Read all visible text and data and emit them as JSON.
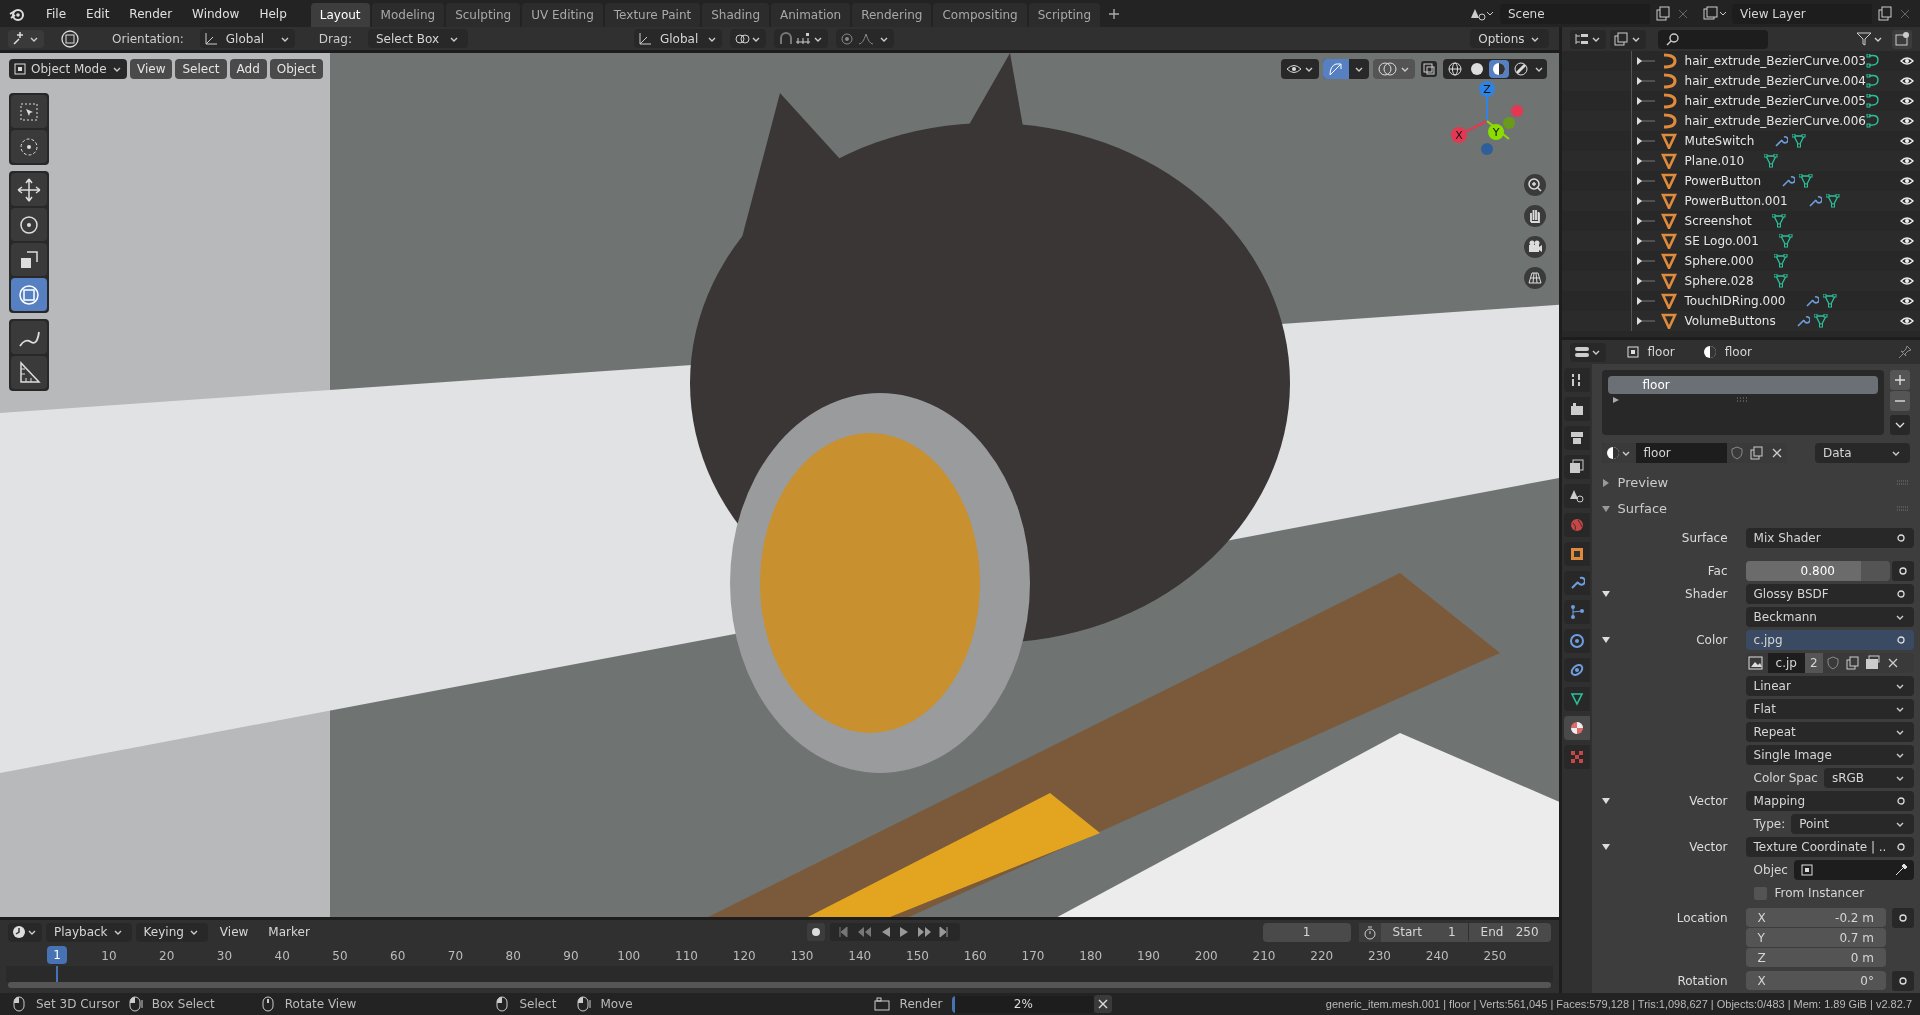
{
  "menu": [
    "File",
    "Edit",
    "Render",
    "Window",
    "Help"
  ],
  "workspaces": [
    {
      "label": "Layout",
      "selected": true
    },
    {
      "label": "Modeling",
      "selected": false
    },
    {
      "label": "Sculpting",
      "selected": false
    },
    {
      "label": "UV Editing",
      "selected": false
    },
    {
      "label": "Texture Paint",
      "selected": false
    },
    {
      "label": "Shading",
      "selected": false
    },
    {
      "label": "Animation",
      "selected": false
    },
    {
      "label": "Rendering",
      "selected": false
    },
    {
      "label": "Compositing",
      "selected": false
    },
    {
      "label": "Scripting",
      "selected": false
    }
  ],
  "scene": "Scene",
  "view_layer": "View Layer",
  "tool_header": {
    "orientation_label": "Orientation:",
    "orientation": "Global",
    "drag_label": "Drag:",
    "drag": "Select Box",
    "transform_orientation": "Global",
    "options": "Options"
  },
  "viewport_header": {
    "mode": "Object Mode",
    "menus": [
      "View",
      "Select",
      "Add",
      "Object"
    ]
  },
  "viewport_overlays": {
    "on": true
  },
  "viewport_shading": [
    {
      "kind": "wireframe",
      "selected": false
    },
    {
      "kind": "solid",
      "selected": false
    },
    {
      "kind": "material",
      "selected": true
    },
    {
      "kind": "rendered",
      "selected": false
    }
  ],
  "tools": [
    {
      "kind": "select",
      "selected": false
    },
    {
      "kind": "cursor",
      "selected": false
    },
    {
      "kind": "move",
      "selected": false
    },
    {
      "kind": "rotate",
      "selected": false
    },
    {
      "kind": "scale",
      "selected": false
    },
    {
      "kind": "transform",
      "selected": true
    },
    {
      "kind": "annotate",
      "selected": false
    },
    {
      "kind": "measure",
      "selected": false
    }
  ],
  "gizmo_axes": [
    "X",
    "Y",
    "Z"
  ],
  "outliner": [
    {
      "name": "hair_extrude_BezierCurve.003",
      "kind": "curve",
      "modifier": false
    },
    {
      "name": "hair_extrude_BezierCurve.004",
      "kind": "curve",
      "modifier": false
    },
    {
      "name": "hair_extrude_BezierCurve.005",
      "kind": "curve",
      "modifier": false
    },
    {
      "name": "hair_extrude_BezierCurve.006",
      "kind": "curve",
      "modifier": false
    },
    {
      "name": "MuteSwitch",
      "kind": "mesh",
      "modifier": true
    },
    {
      "name": "Plane.010",
      "kind": "mesh",
      "modifier": false
    },
    {
      "name": "PowerButton",
      "kind": "mesh",
      "modifier": true
    },
    {
      "name": "PowerButton.001",
      "kind": "mesh",
      "modifier": true
    },
    {
      "name": "Screenshot",
      "kind": "mesh",
      "modifier": false
    },
    {
      "name": "SE Logo.001",
      "kind": "mesh",
      "modifier": false
    },
    {
      "name": "Sphere.000",
      "kind": "mesh",
      "modifier": false
    },
    {
      "name": "Sphere.028",
      "kind": "mesh",
      "modifier": false
    },
    {
      "name": "TouchIDRing.000",
      "kind": "mesh",
      "modifier": true
    },
    {
      "name": "VolumeButtons",
      "kind": "mesh",
      "modifier": true
    }
  ],
  "properties": {
    "breadcrumbs": [
      "floor",
      "floor"
    ],
    "tabs": [
      {
        "kind": "tool",
        "selected": false
      },
      {
        "kind": "render",
        "selected": false
      },
      {
        "kind": "output",
        "selected": false
      },
      {
        "kind": "view_layer",
        "selected": false
      },
      {
        "kind": "scene",
        "selected": false
      },
      {
        "kind": "world",
        "selected": false
      },
      {
        "kind": "object",
        "selected": false
      },
      {
        "kind": "modifiers",
        "selected": false
      },
      {
        "kind": "particles",
        "selected": false
      },
      {
        "kind": "physics",
        "selected": false
      },
      {
        "kind": "constraints",
        "selected": false
      },
      {
        "kind": "data",
        "selected": false
      },
      {
        "kind": "material",
        "selected": true
      },
      {
        "kind": "texture",
        "selected": false
      }
    ],
    "slots": [
      {
        "name": "floor",
        "selected": true
      }
    ],
    "material": "floor",
    "link": "Data",
    "panels": [
      {
        "title": "Preview",
        "expanded": false
      },
      {
        "title": "Surface",
        "expanded": true
      }
    ],
    "rows": [
      {
        "kind": "socket",
        "label": "Surface",
        "value": "Mix Shader",
        "active": false
      },
      {
        "kind": "slider",
        "label": "Fac",
        "value": "0.800",
        "level": 0.8
      },
      {
        "kind": "socket",
        "label": "Shader",
        "value": "Glossy BSDF",
        "active": false,
        "expanded": true
      },
      {
        "kind": "dropdown",
        "value": "Beckmann"
      },
      {
        "kind": "socket",
        "label": "Color",
        "value": "c.jpg",
        "active": true,
        "expanded": true
      },
      {
        "kind": "image",
        "name": "c.jp",
        "users": "2"
      },
      {
        "kind": "dropdown",
        "value": "Linear"
      },
      {
        "kind": "dropdown",
        "value": "Flat"
      },
      {
        "kind": "dropdown",
        "value": "Repeat"
      },
      {
        "kind": "dropdown",
        "value": "Single Image"
      },
      {
        "kind": "labeled_dropdown",
        "label": "Color Spac",
        "value": "sRGB"
      },
      {
        "kind": "socket",
        "label": "Vector",
        "value": "Mapping",
        "active": false,
        "expanded": true
      },
      {
        "kind": "labeled_dropdown",
        "label": "Type:",
        "value": "Point"
      },
      {
        "kind": "socket",
        "label": "Vector",
        "value": "Texture Coordinate | ..",
        "active": false,
        "expanded": true
      },
      {
        "kind": "object",
        "label": "Objec"
      },
      {
        "kind": "checkbox",
        "label": "From Instancer",
        "checked": false
      },
      {
        "kind": "vector",
        "label": "Location",
        "axes": [
          {
            "axis": "X",
            "value": "-0.2 m"
          },
          {
            "axis": "Y",
            "value": "0.7 m"
          },
          {
            "axis": "Z",
            "value": "0 m"
          }
        ]
      },
      {
        "kind": "vector",
        "label": "Rotation",
        "axes": [
          {
            "axis": "X",
            "value": "0°"
          }
        ]
      }
    ]
  },
  "timeline": {
    "menus": [
      "Playback",
      "Keying",
      "View",
      "Marker"
    ],
    "current_frame": "1",
    "start_label": "Start",
    "start": "1",
    "end_label": "End",
    "end": "250",
    "ticks": [
      "1",
      "10",
      "20",
      "30",
      "40",
      "50",
      "60",
      "70",
      "80",
      "90",
      "100",
      "110",
      "120",
      "130",
      "140",
      "150",
      "160",
      "170",
      "180",
      "190",
      "200",
      "210",
      "220",
      "230",
      "240",
      "250"
    ]
  },
  "status": {
    "hints": [
      {
        "kind": "mouse_left",
        "label": "Set 3D Cursor"
      },
      {
        "kind": "mouse_drag",
        "label": "Box Select"
      },
      {
        "kind": "mouse_middle",
        "label": "Rotate View"
      },
      {
        "kind": "mouse_left",
        "label": "Select"
      },
      {
        "kind": "mouse_drag",
        "label": "Move"
      }
    ],
    "render": {
      "label": "Render",
      "progress": "2%",
      "level": 0.02
    },
    "stats": "generic_item.mesh.001 | floor | Verts:561,045 | Faces:579,128 | Tris:1,098,627 | Objects:0/483 | Mem: 1.89 GiB | v2.82.7"
  }
}
